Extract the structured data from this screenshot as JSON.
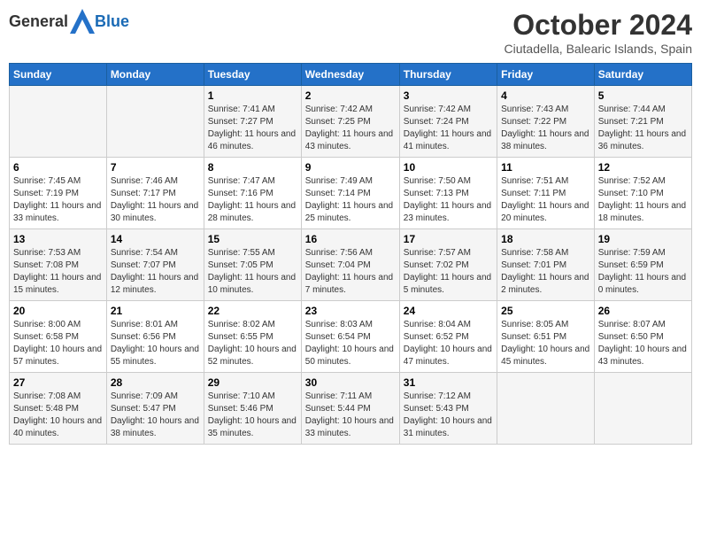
{
  "header": {
    "logo_general": "General",
    "logo_blue": "Blue",
    "month": "October 2024",
    "location": "Ciutadella, Balearic Islands, Spain"
  },
  "columns": [
    "Sunday",
    "Monday",
    "Tuesday",
    "Wednesday",
    "Thursday",
    "Friday",
    "Saturday"
  ],
  "weeks": [
    [
      {
        "day": "",
        "sunrise": "",
        "sunset": "",
        "daylight": ""
      },
      {
        "day": "",
        "sunrise": "",
        "sunset": "",
        "daylight": ""
      },
      {
        "day": "1",
        "sunrise": "Sunrise: 7:41 AM",
        "sunset": "Sunset: 7:27 PM",
        "daylight": "Daylight: 11 hours and 46 minutes."
      },
      {
        "day": "2",
        "sunrise": "Sunrise: 7:42 AM",
        "sunset": "Sunset: 7:25 PM",
        "daylight": "Daylight: 11 hours and 43 minutes."
      },
      {
        "day": "3",
        "sunrise": "Sunrise: 7:42 AM",
        "sunset": "Sunset: 7:24 PM",
        "daylight": "Daylight: 11 hours and 41 minutes."
      },
      {
        "day": "4",
        "sunrise": "Sunrise: 7:43 AM",
        "sunset": "Sunset: 7:22 PM",
        "daylight": "Daylight: 11 hours and 38 minutes."
      },
      {
        "day": "5",
        "sunrise": "Sunrise: 7:44 AM",
        "sunset": "Sunset: 7:21 PM",
        "daylight": "Daylight: 11 hours and 36 minutes."
      }
    ],
    [
      {
        "day": "6",
        "sunrise": "Sunrise: 7:45 AM",
        "sunset": "Sunset: 7:19 PM",
        "daylight": "Daylight: 11 hours and 33 minutes."
      },
      {
        "day": "7",
        "sunrise": "Sunrise: 7:46 AM",
        "sunset": "Sunset: 7:17 PM",
        "daylight": "Daylight: 11 hours and 30 minutes."
      },
      {
        "day": "8",
        "sunrise": "Sunrise: 7:47 AM",
        "sunset": "Sunset: 7:16 PM",
        "daylight": "Daylight: 11 hours and 28 minutes."
      },
      {
        "day": "9",
        "sunrise": "Sunrise: 7:49 AM",
        "sunset": "Sunset: 7:14 PM",
        "daylight": "Daylight: 11 hours and 25 minutes."
      },
      {
        "day": "10",
        "sunrise": "Sunrise: 7:50 AM",
        "sunset": "Sunset: 7:13 PM",
        "daylight": "Daylight: 11 hours and 23 minutes."
      },
      {
        "day": "11",
        "sunrise": "Sunrise: 7:51 AM",
        "sunset": "Sunset: 7:11 PM",
        "daylight": "Daylight: 11 hours and 20 minutes."
      },
      {
        "day": "12",
        "sunrise": "Sunrise: 7:52 AM",
        "sunset": "Sunset: 7:10 PM",
        "daylight": "Daylight: 11 hours and 18 minutes."
      }
    ],
    [
      {
        "day": "13",
        "sunrise": "Sunrise: 7:53 AM",
        "sunset": "Sunset: 7:08 PM",
        "daylight": "Daylight: 11 hours and 15 minutes."
      },
      {
        "day": "14",
        "sunrise": "Sunrise: 7:54 AM",
        "sunset": "Sunset: 7:07 PM",
        "daylight": "Daylight: 11 hours and 12 minutes."
      },
      {
        "day": "15",
        "sunrise": "Sunrise: 7:55 AM",
        "sunset": "Sunset: 7:05 PM",
        "daylight": "Daylight: 11 hours and 10 minutes."
      },
      {
        "day": "16",
        "sunrise": "Sunrise: 7:56 AM",
        "sunset": "Sunset: 7:04 PM",
        "daylight": "Daylight: 11 hours and 7 minutes."
      },
      {
        "day": "17",
        "sunrise": "Sunrise: 7:57 AM",
        "sunset": "Sunset: 7:02 PM",
        "daylight": "Daylight: 11 hours and 5 minutes."
      },
      {
        "day": "18",
        "sunrise": "Sunrise: 7:58 AM",
        "sunset": "Sunset: 7:01 PM",
        "daylight": "Daylight: 11 hours and 2 minutes."
      },
      {
        "day": "19",
        "sunrise": "Sunrise: 7:59 AM",
        "sunset": "Sunset: 6:59 PM",
        "daylight": "Daylight: 11 hours and 0 minutes."
      }
    ],
    [
      {
        "day": "20",
        "sunrise": "Sunrise: 8:00 AM",
        "sunset": "Sunset: 6:58 PM",
        "daylight": "Daylight: 10 hours and 57 minutes."
      },
      {
        "day": "21",
        "sunrise": "Sunrise: 8:01 AM",
        "sunset": "Sunset: 6:56 PM",
        "daylight": "Daylight: 10 hours and 55 minutes."
      },
      {
        "day": "22",
        "sunrise": "Sunrise: 8:02 AM",
        "sunset": "Sunset: 6:55 PM",
        "daylight": "Daylight: 10 hours and 52 minutes."
      },
      {
        "day": "23",
        "sunrise": "Sunrise: 8:03 AM",
        "sunset": "Sunset: 6:54 PM",
        "daylight": "Daylight: 10 hours and 50 minutes."
      },
      {
        "day": "24",
        "sunrise": "Sunrise: 8:04 AM",
        "sunset": "Sunset: 6:52 PM",
        "daylight": "Daylight: 10 hours and 47 minutes."
      },
      {
        "day": "25",
        "sunrise": "Sunrise: 8:05 AM",
        "sunset": "Sunset: 6:51 PM",
        "daylight": "Daylight: 10 hours and 45 minutes."
      },
      {
        "day": "26",
        "sunrise": "Sunrise: 8:07 AM",
        "sunset": "Sunset: 6:50 PM",
        "daylight": "Daylight: 10 hours and 43 minutes."
      }
    ],
    [
      {
        "day": "27",
        "sunrise": "Sunrise: 7:08 AM",
        "sunset": "Sunset: 5:48 PM",
        "daylight": "Daylight: 10 hours and 40 minutes."
      },
      {
        "day": "28",
        "sunrise": "Sunrise: 7:09 AM",
        "sunset": "Sunset: 5:47 PM",
        "daylight": "Daylight: 10 hours and 38 minutes."
      },
      {
        "day": "29",
        "sunrise": "Sunrise: 7:10 AM",
        "sunset": "Sunset: 5:46 PM",
        "daylight": "Daylight: 10 hours and 35 minutes."
      },
      {
        "day": "30",
        "sunrise": "Sunrise: 7:11 AM",
        "sunset": "Sunset: 5:44 PM",
        "daylight": "Daylight: 10 hours and 33 minutes."
      },
      {
        "day": "31",
        "sunrise": "Sunrise: 7:12 AM",
        "sunset": "Sunset: 5:43 PM",
        "daylight": "Daylight: 10 hours and 31 minutes."
      },
      {
        "day": "",
        "sunrise": "",
        "sunset": "",
        "daylight": ""
      },
      {
        "day": "",
        "sunrise": "",
        "sunset": "",
        "daylight": ""
      }
    ]
  ]
}
